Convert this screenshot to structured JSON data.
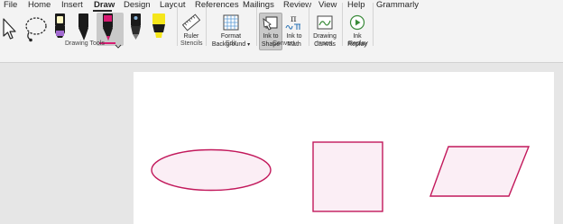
{
  "menu": {
    "file": "File",
    "home": "Home",
    "insert": "Insert",
    "draw": "Draw",
    "design": "Design",
    "layout": "Layout",
    "references": "References",
    "mailings": "Mailings",
    "review": "Review",
    "view": "View",
    "help": "Help",
    "grammarly": "Grammarly"
  },
  "ribbon": {
    "groups": {
      "drawing_tools": "Drawing Tools",
      "stencils": "Stencils",
      "edit": "Edit",
      "convert": "Convert",
      "insert": "Insert",
      "replay": "Replay"
    },
    "ruler": "Ruler",
    "format_background_1": "Format",
    "format_background_2": "Background",
    "ink_to_shape_1": "Ink to",
    "ink_to_shape_2": "Shape",
    "ink_to_math_1": "Ink to",
    "ink_to_math_2": "Math",
    "drawing_canvas_1": "Drawing",
    "drawing_canvas_2": "Canvas",
    "ink_replay_1": "Ink",
    "ink_replay_2": "Replay",
    "math_glyph": "π"
  },
  "colors": {
    "accent": "#c2185b",
    "shape_fill": "#fbeef5",
    "highlighter": "#f5e61b",
    "pen_pink": "#d81b72"
  }
}
